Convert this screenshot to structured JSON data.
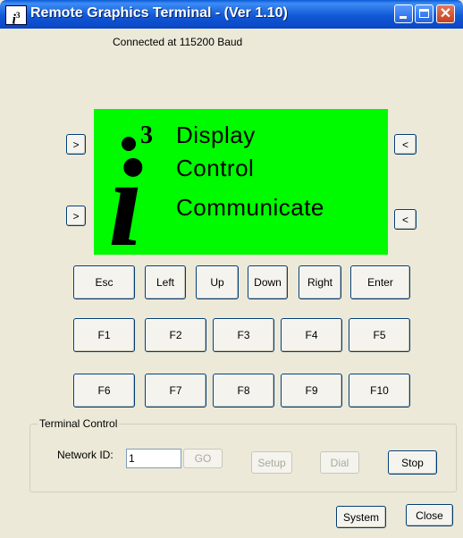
{
  "window": {
    "title": "Remote Graphics Terminal - (Ver 1.10)",
    "icon_label": "i",
    "icon_sup": "3",
    "min_icon": "minimize-icon",
    "max_icon": "maximize-icon",
    "close_glyph": "✕"
  },
  "status_text": "Connected at 115200 Baud",
  "lcd": {
    "background": "#00fa00",
    "logo_letter": "i",
    "logo_superscript": "3",
    "lines": [
      "Display",
      "Control",
      "Communicate"
    ]
  },
  "soft_keys": {
    "left": [
      ">",
      ">"
    ],
    "right": [
      "<",
      "<"
    ]
  },
  "nav_buttons": [
    "Esc",
    "Left",
    "Up",
    "Down",
    "Right",
    "Enter"
  ],
  "fkeys_row1": [
    "F1",
    "F2",
    "F3",
    "F4",
    "F5"
  ],
  "fkeys_row2": [
    "F6",
    "F7",
    "F8",
    "F9",
    "F10"
  ],
  "terminal_control": {
    "label": "Terminal Control",
    "network_id_label": "Network ID:",
    "network_id_value": "1",
    "go_label": "GO",
    "setup_label": "Setup",
    "dial_label": "Dial",
    "stop_label": "Stop"
  },
  "footer": {
    "system_label": "System",
    "close_label": "Close"
  }
}
